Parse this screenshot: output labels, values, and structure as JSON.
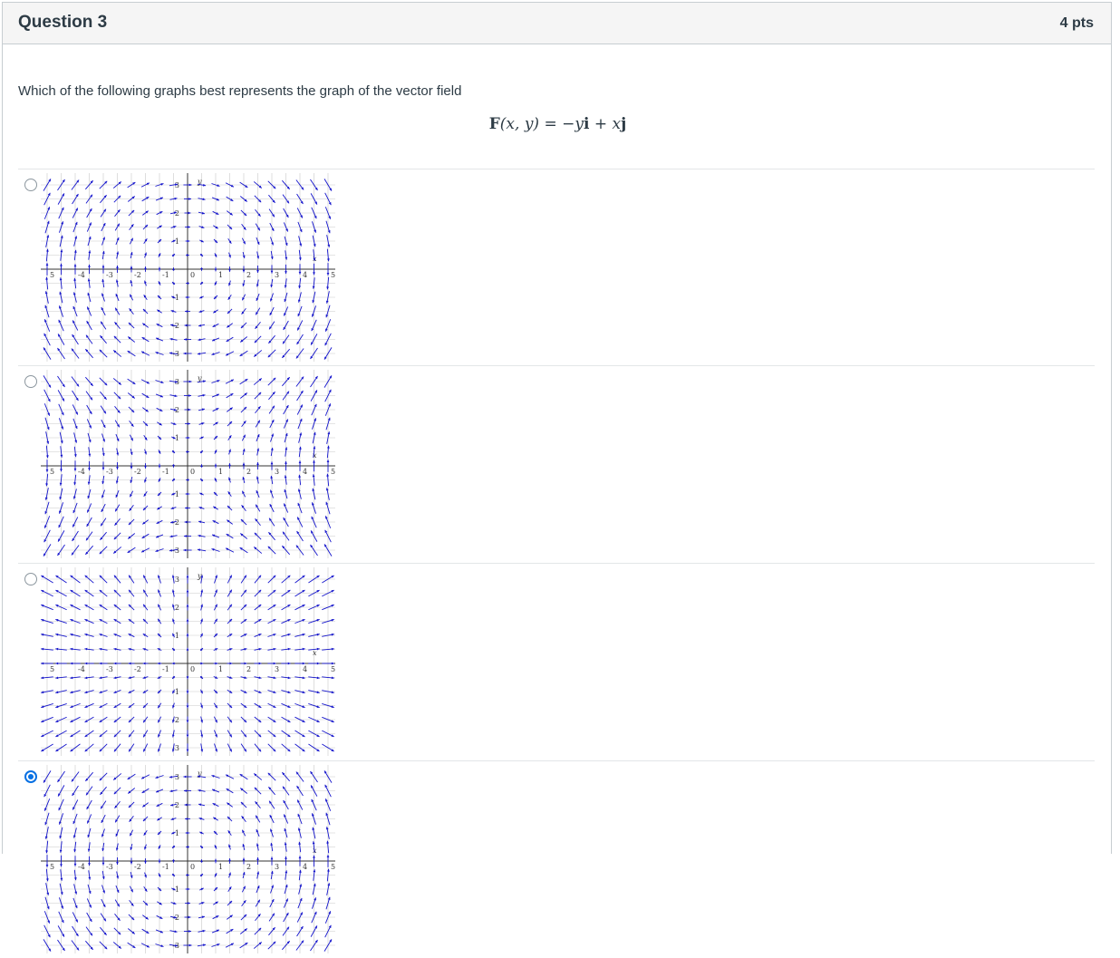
{
  "question": {
    "title": "Question 3",
    "points": "4 pts",
    "prompt": "Which of the following graphs best represents the graph of the vector field",
    "formula": {
      "lhs_bold": "F",
      "lhs_args": "(x, y)",
      "equals": " = ",
      "minus": "−",
      "y": "y",
      "i": "i",
      "plus": " + ",
      "x": "x",
      "j": "j"
    }
  },
  "graph_labels": {
    "x_ticks": [
      "5",
      "-4",
      "-3",
      "-2",
      "-1",
      "0",
      "1",
      "2",
      "3",
      "4",
      "5"
    ],
    "y_ticks": [
      "3",
      "2",
      "1",
      "-1",
      "-2",
      "-3"
    ],
    "x_axis": "x",
    "y_axis": "y"
  },
  "answers": [
    {
      "field": "swirl-cw",
      "selected": false
    },
    {
      "field": "x-down-y-right",
      "selected": false
    },
    {
      "field": "xy-quadrant",
      "selected": false
    },
    {
      "field": "swirl-ccw",
      "selected": true
    }
  ],
  "colors": {
    "arrow": "#1414cc",
    "grid": "#c9c9c9",
    "accent": "#0770e3"
  }
}
